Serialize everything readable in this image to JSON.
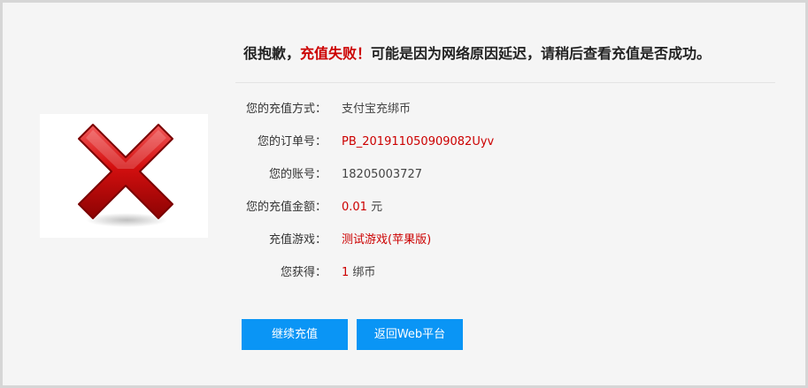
{
  "page": {
    "background": "#f5f5f5"
  },
  "icon": {
    "name": "failure-x-icon",
    "color": "#cc0000"
  },
  "headline": {
    "prefix": "很抱歉，",
    "highlight": "充值失败！",
    "suffix": "可能是因为网络原因延迟，请稍后查看充值是否成功。"
  },
  "details": {
    "method": {
      "label": "您的充值方式：",
      "value": "支付宝充绑币"
    },
    "order": {
      "label": "您的订单号：",
      "value": "PB_201911050909082Uyv"
    },
    "account": {
      "label": "您的账号：",
      "value": "18205003727"
    },
    "amount": {
      "label": "您的充值金额：",
      "value": "0.01",
      "unit": "元"
    },
    "game": {
      "label": "充值游戏：",
      "value": "测试游戏(苹果版)"
    },
    "obtained": {
      "label": "您获得：",
      "value": "1",
      "unit": "绑币"
    }
  },
  "buttons": {
    "continue_label": "继续充值",
    "back_label": "返回Web平台",
    "color": "#0a95f5"
  }
}
